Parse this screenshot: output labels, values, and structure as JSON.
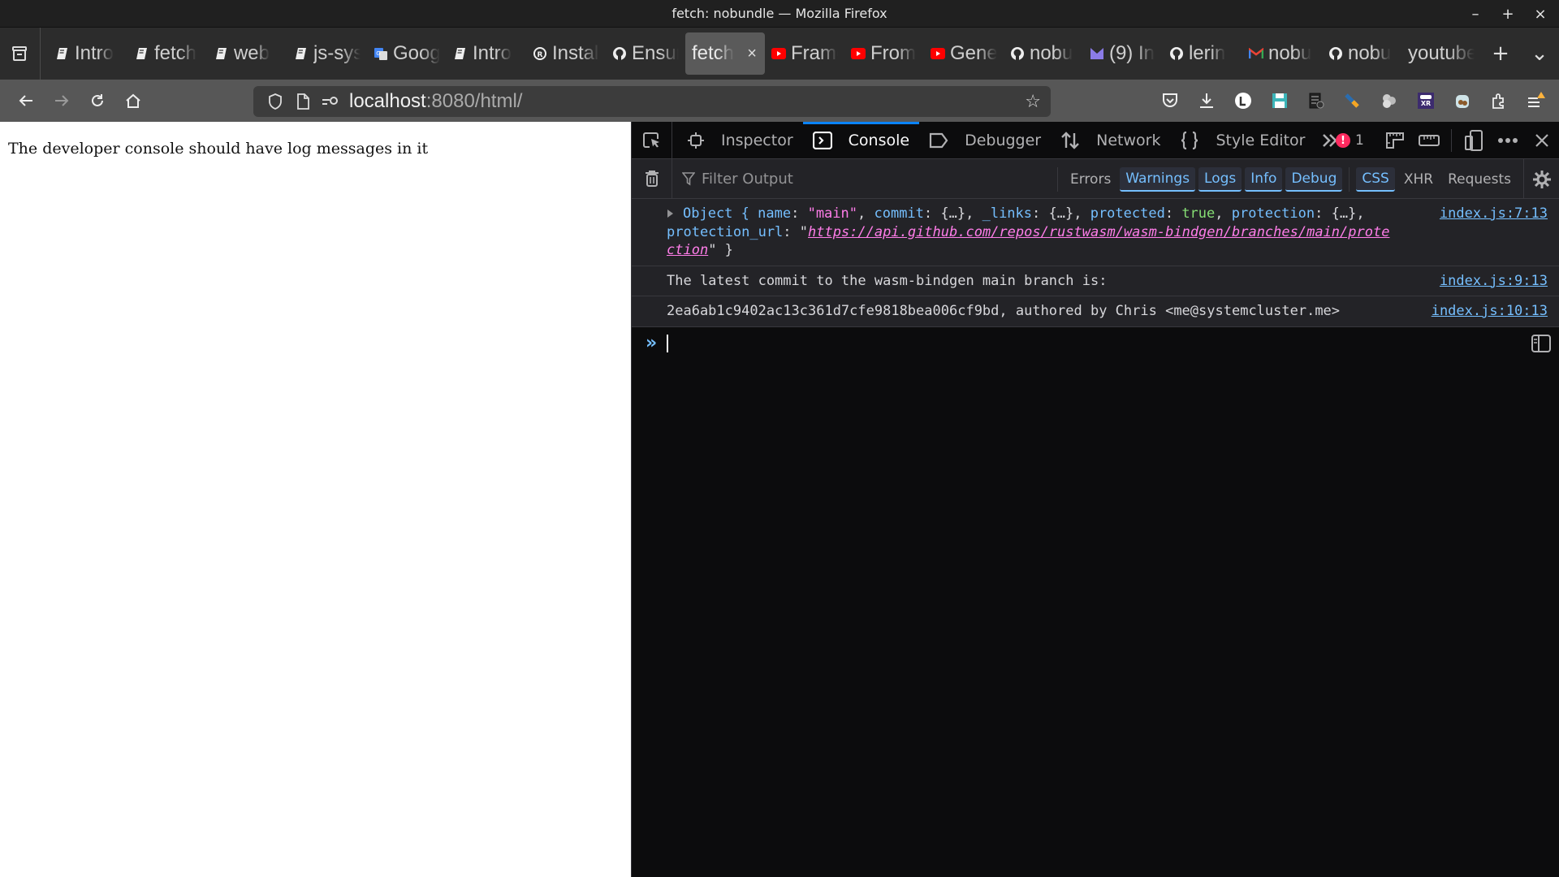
{
  "window": {
    "title": "fetch: nobundle — Mozilla Firefox",
    "controls": {
      "minimize": "–",
      "maximize": "+",
      "close": "×"
    }
  },
  "tabs": [
    {
      "label": "Intro",
      "icon": "mdbook-icon"
    },
    {
      "label": "fetch",
      "icon": "mdbook-icon"
    },
    {
      "label": "web",
      "icon": "mdbook-icon"
    },
    {
      "label": "js-sys",
      "icon": "mdbook-icon"
    },
    {
      "label": "Google",
      "icon": "google-translate-icon"
    },
    {
      "label": "Intro",
      "icon": "mdbook-icon"
    },
    {
      "label": "Install",
      "icon": "rust-icon"
    },
    {
      "label": "Ensure",
      "icon": "github-icon"
    },
    {
      "label": "fetch",
      "icon": "none",
      "active": true,
      "close": "×"
    },
    {
      "label": "Frame",
      "icon": "youtube-icon"
    },
    {
      "label": "From",
      "icon": "youtube-icon"
    },
    {
      "label": "Gene",
      "icon": "youtube-icon"
    },
    {
      "label": "nobu",
      "icon": "github-icon"
    },
    {
      "label": "(9) In",
      "icon": "proton-mail-icon"
    },
    {
      "label": "lerin",
      "icon": "github-icon"
    },
    {
      "label": "nobu",
      "icon": "gmail-icon"
    },
    {
      "label": "nobu",
      "icon": "github-icon"
    },
    {
      "label": "youtube",
      "icon": "none"
    }
  ],
  "tabbar": {
    "new_tab": "+",
    "list_all": "⌄"
  },
  "navbar": {
    "url_host": "localhost",
    "url_rest": ":8080/html/"
  },
  "page": {
    "text": "The developer console should have log messages in it"
  },
  "devtools": {
    "tabs": [
      {
        "label": "Inspector",
        "icon": "inspector-icon"
      },
      {
        "label": "Console",
        "icon": "console-icon",
        "active": true
      },
      {
        "label": "Debugger",
        "icon": "debugger-icon"
      },
      {
        "label": "Network",
        "icon": "network-icon"
      },
      {
        "label": "Style Editor",
        "icon": "style-editor-icon"
      }
    ],
    "error_count": "1",
    "filter": {
      "placeholder": "Filter Output",
      "buttons": [
        {
          "label": "Errors",
          "on": false
        },
        {
          "label": "Warnings",
          "on": true
        },
        {
          "label": "Logs",
          "on": true
        },
        {
          "label": "Info",
          "on": true
        },
        {
          "label": "Debug",
          "on": true
        },
        {
          "label": "CSS",
          "on": true
        },
        {
          "label": "XHR",
          "on": false
        },
        {
          "label": "Requests",
          "on": false
        }
      ]
    },
    "messages": [
      {
        "object": {
          "prefix": "Object {",
          "name_key": "name",
          "name_val": "\"main\"",
          "commit_key": "commit",
          "collapsed": "{…}",
          "links_key": "_links",
          "protected_key": "protected",
          "protected_val": "true",
          "protection_key": "protection",
          "url_key": "protection_url",
          "url_val_1": "https://api.github.com/repos/rustwasm/wasm-bindgen/branches/main/prote",
          "url_val_2": "ction",
          "suffix": "\" }"
        },
        "source": "index.js:7:13"
      },
      {
        "text": "The latest commit to the wasm-bindgen main branch is:",
        "source": "index.js:9:13"
      },
      {
        "text": "2ea6ab1c9402ac13c361d7cfe9818bea006cf9bd, authored by Chris <me@systemcluster.me>",
        "source": "index.js:10:13"
      }
    ],
    "prompt": "»"
  }
}
